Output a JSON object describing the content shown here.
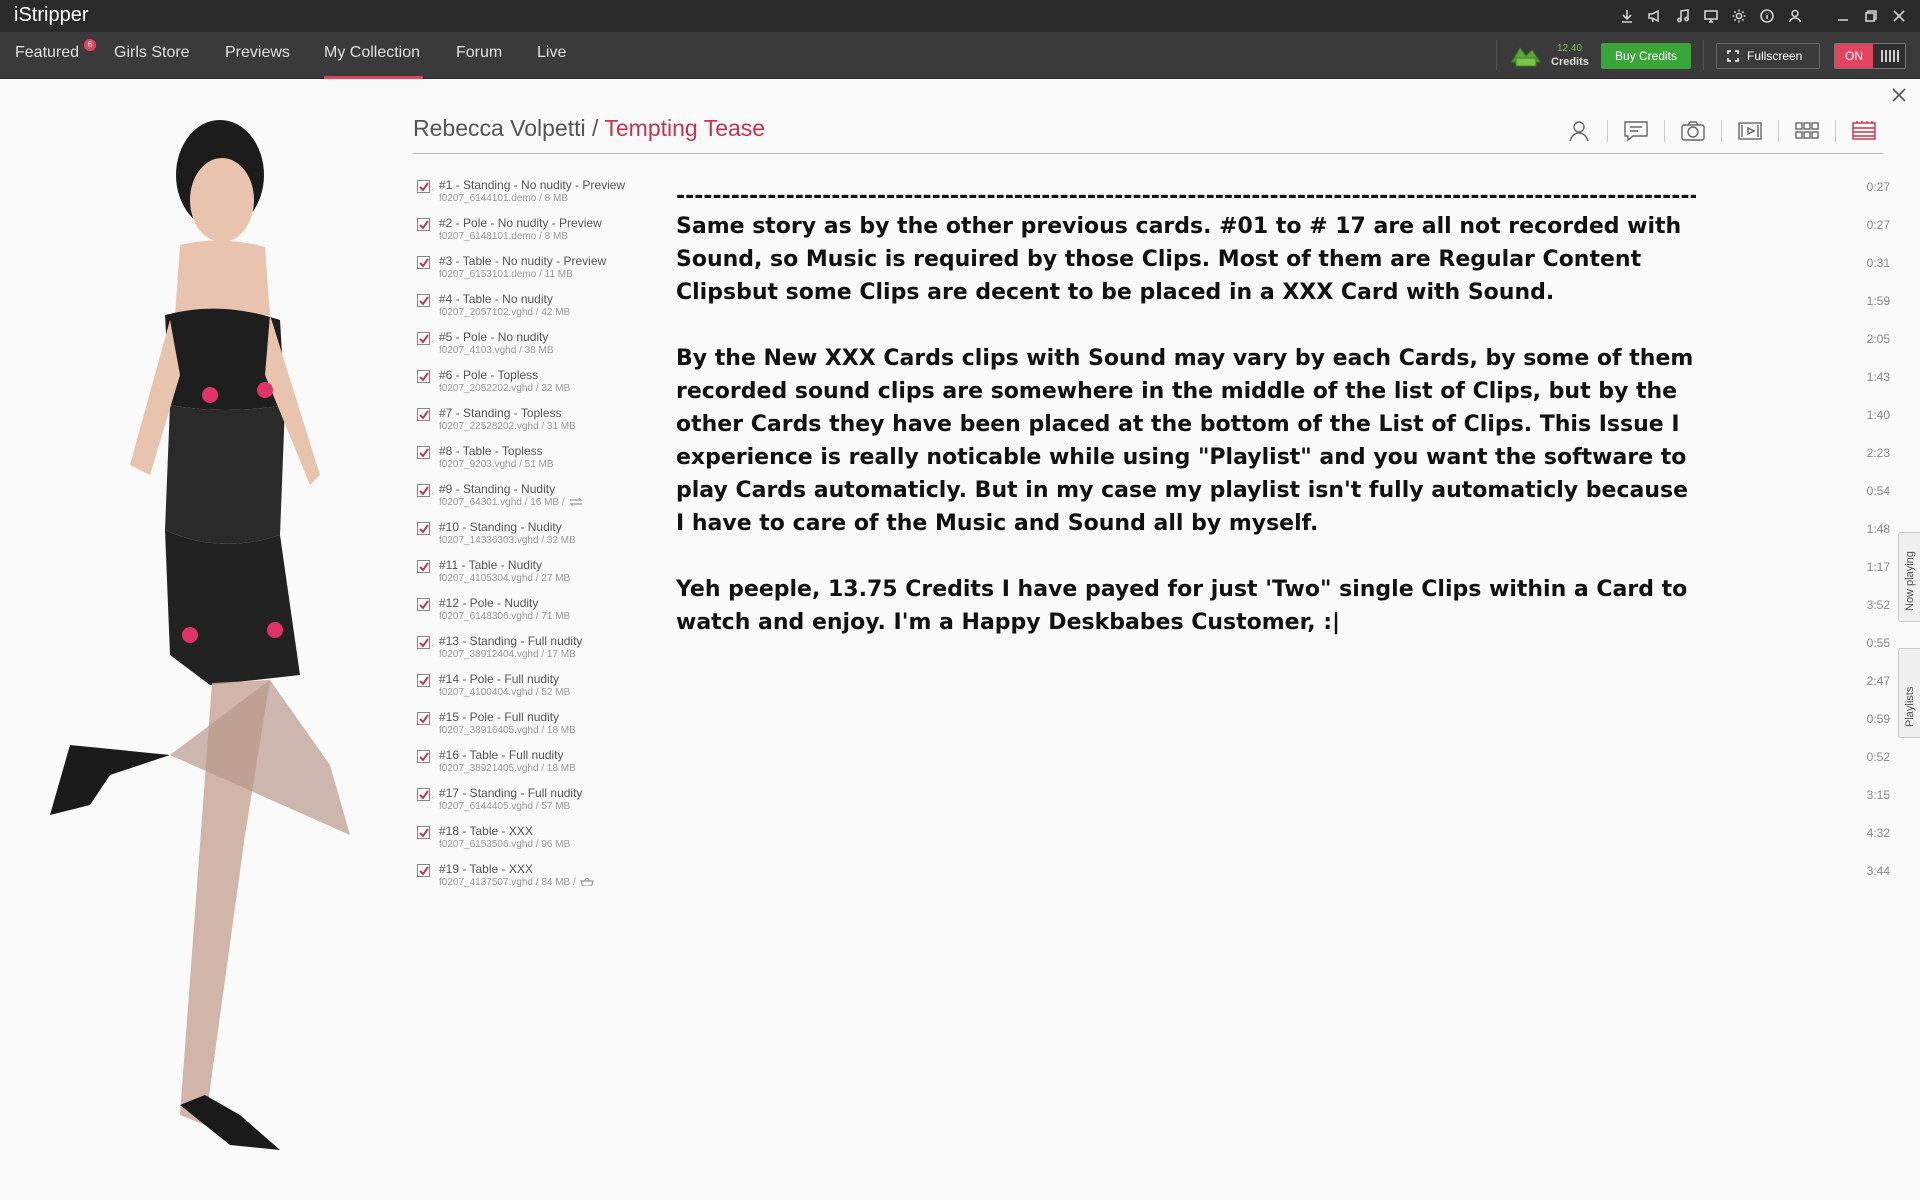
{
  "app": {
    "logo": "iStripper"
  },
  "nav": {
    "items": [
      {
        "label": "Featured",
        "badge": "6"
      },
      {
        "label": "Girls Store"
      },
      {
        "label": "Previews"
      },
      {
        "label": "My Collection",
        "active": true
      },
      {
        "label": "Forum"
      },
      {
        "label": "Live"
      }
    ],
    "credits_value": "12.40",
    "credits_label": "Credits",
    "buy_label": "Buy Credits",
    "fullscreen_label": "Fullscreen",
    "on_label": "ON"
  },
  "card": {
    "model": "Rebecca Volpetti",
    "separator": " / ",
    "name": "Tempting Tease"
  },
  "view_icons": [
    "profile-icon",
    "comments-icon",
    "photos-icon",
    "clips-icon",
    "grid-icon",
    "cards-icon"
  ],
  "clips": [
    {
      "title": "#1 - Standing - No nudity - Preview",
      "file": "f0207_6144101.demo / 8 MB",
      "duration": "0:27"
    },
    {
      "title": "#2 - Pole - No nudity - Preview",
      "file": "f0207_6148101.demo / 8 MB",
      "duration": "0:27"
    },
    {
      "title": "#3 - Table - No nudity - Preview",
      "file": "f0207_6153101.demo / 11 MB",
      "duration": "0:31"
    },
    {
      "title": "#4 - Table - No nudity",
      "file": "f0207_2057102.vghd / 42 MB",
      "duration": "1:59"
    },
    {
      "title": "#5 - Pole - No nudity",
      "file": "f0207_4103.vghd / 38 MB",
      "duration": "2:05"
    },
    {
      "title": "#6 - Pole - Topless",
      "file": "f0207_2052202.vghd / 32 MB",
      "duration": "1:43"
    },
    {
      "title": "#7 - Standing - Topless",
      "file": "f0207_22528202.vghd / 31 MB",
      "duration": "1:40"
    },
    {
      "title": "#8 - Table - Topless",
      "file": "f0207_9203.vghd / 51 MB",
      "duration": "2:23"
    },
    {
      "title": "#9 - Standing - Nudity",
      "file": "f0207_64301.vghd / 16 MB /",
      "duration": "0:54",
      "icon": "swap-icon"
    },
    {
      "title": "#10 - Standing - Nudity",
      "file": "f0207_14336303.vghd / 32 MB",
      "duration": "1:48"
    },
    {
      "title": "#11 - Table - Nudity",
      "file": "f0207_4105304.vghd / 27 MB",
      "duration": "1:17"
    },
    {
      "title": "#12 - Pole - Nudity",
      "file": "f0207_6148306.vghd / 71 MB",
      "duration": "3:52"
    },
    {
      "title": "#13 - Standing - Full nudity",
      "file": "f0207_38912404.vghd / 17 MB",
      "duration": "0:55"
    },
    {
      "title": "#14 - Pole - Full nudity",
      "file": "f0207_4100404.vghd / 52 MB",
      "duration": "2:47"
    },
    {
      "title": "#15 - Pole - Full nudity",
      "file": "f0207_38916405.vghd / 18 MB",
      "duration": "0:59"
    },
    {
      "title": "#16 - Table - Full nudity",
      "file": "f0207_38921405.vghd / 18 MB",
      "duration": "0:52"
    },
    {
      "title": "#17 - Standing - Full nudity",
      "file": "f0207_6144405.vghd / 57 MB",
      "duration": "3:15"
    },
    {
      "title": "#18 - Table - XXX",
      "file": "f0207_6153506.vghd / 96 MB",
      "duration": "4:32"
    },
    {
      "title": "#19 - Table - XXX",
      "file": "f0207_4137507.vghd / 84 MB /",
      "duration": "3:44",
      "icon": "basket-icon"
    }
  ],
  "description": {
    "dashes": "------------------------------------------------------------------------------------------------------------------------",
    "p1": "Same story as by the other previous cards. #01 to # 17 are all not recorded with Sound, so Music is required by those Clips. Most of them are Regular Content Clipsbut some Clips are decent to be placed in a XXX Card with Sound.",
    "p2": "By the New XXX Cards clips with Sound may vary by each Cards, by some of them recorded sound clips are somewhere in the middle of the list of Clips, but by the other Cards they have been placed at the bottom of the List of Clips. This Issue I experience is really noticable while using \"Playlist\" and you want the software to play Cards automaticly. But in my case my playlist isn't fully automaticly because I have to care of the Music and Sound all by myself.",
    "p3": "Yeh peeple, 13.75 Credits I have payed for just 'Two\" single Clips within a Card to watch and enjoy. I'm a Happy Deskbabes Customer, :|"
  },
  "side_tabs": {
    "now_playing": "Now playing",
    "playlists": "Playlists"
  },
  "colors": {
    "accent": "#c8334d",
    "buy": "#3aa63a",
    "credits": "#7dc24b"
  }
}
